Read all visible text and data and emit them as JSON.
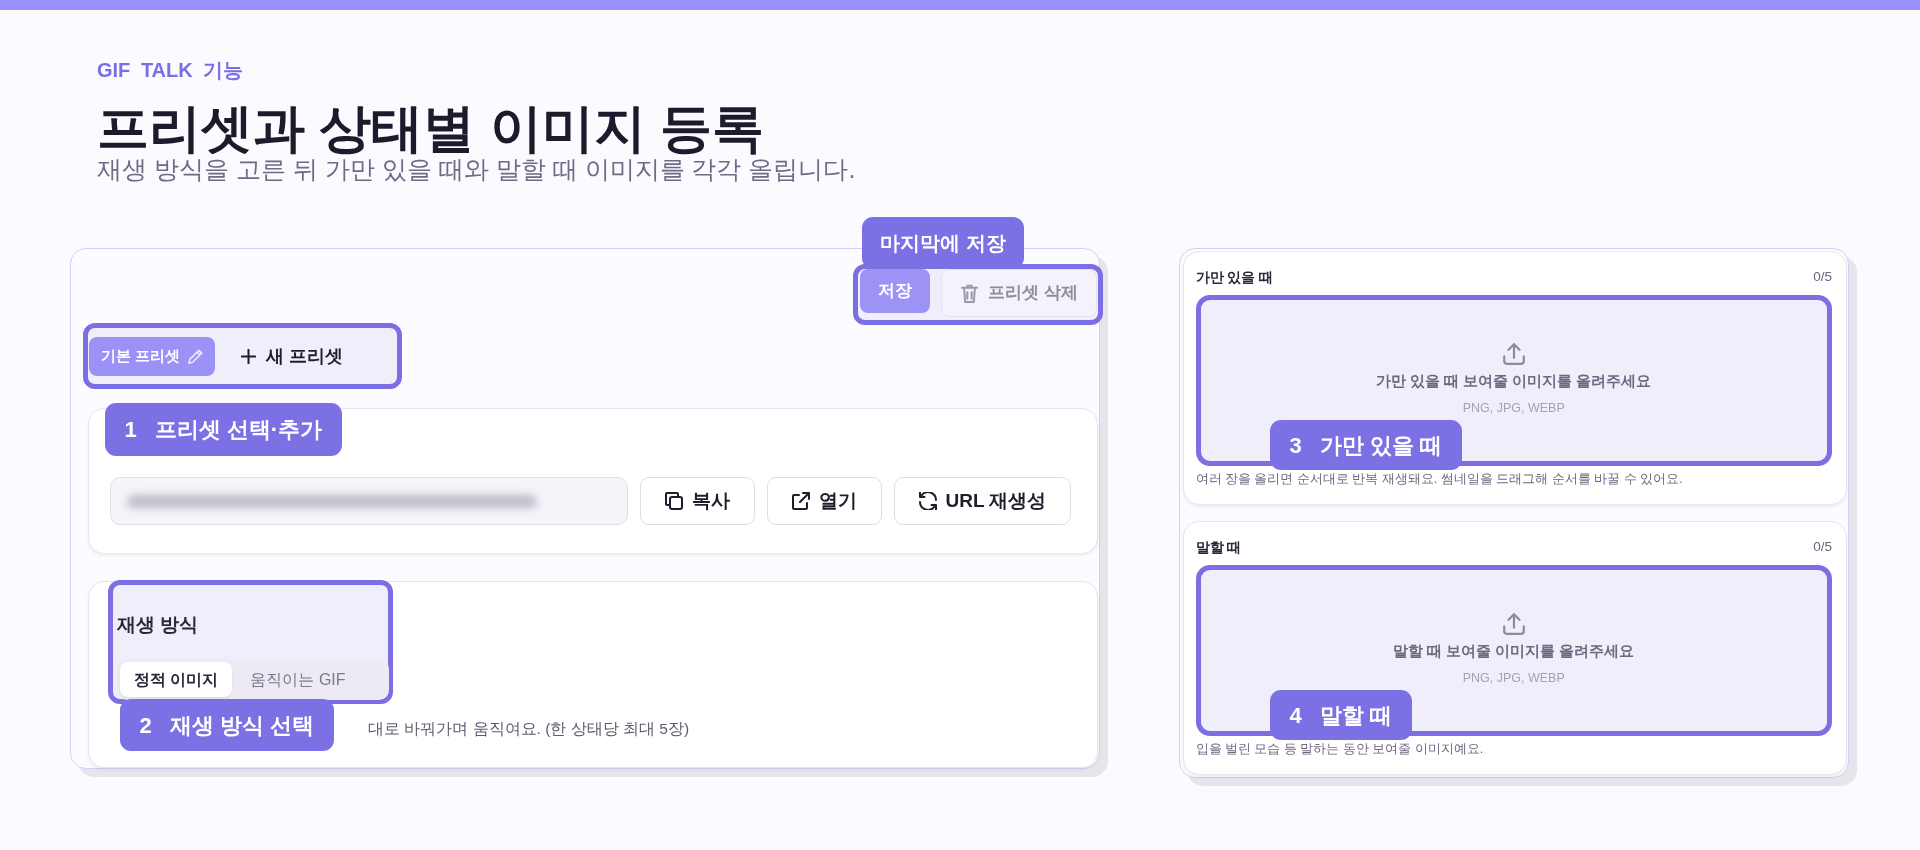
{
  "header": {
    "eyebrow": "GIF TALK 기능",
    "title": "프리셋과 상태별 이미지 등록",
    "subtitle": "재생 방식을 고른 뒤 가만 있을 때와 말할 때 이미지를 각각 올립니다."
  },
  "editor": {
    "actions": {
      "callout": {
        "text": "마지막에 저장"
      },
      "buttons": [
        {
          "kind": "save",
          "label": "저장"
        },
        {
          "kind": "delete",
          "label": "프리셋 삭제"
        }
      ]
    },
    "presets": {
      "items": [
        {
          "label": "기본 프리셋",
          "selected": true
        }
      ],
      "add_label": "새 프리셋"
    },
    "share": {
      "callout": {
        "number": "1",
        "text": "프리셋 선택·추가"
      },
      "buttons": [
        {
          "kind": "copy",
          "label": "복사"
        },
        {
          "kind": "open",
          "label": "열기"
        },
        {
          "kind": "regenerate",
          "label": "URL 재생성"
        }
      ]
    },
    "playback": {
      "callout": {
        "number": "2",
        "text": "재생 방식 선택"
      },
      "label": "재생 방식",
      "options": [
        {
          "label": "정적 이미지",
          "selected": true
        },
        {
          "label": "움직이는 GIF",
          "selected": false
        }
      ],
      "description": "대로 바꿔가며 움직여요. (한 상태당 최대 5장)"
    }
  },
  "states": [
    {
      "title": "가만 있을 때",
      "count": "0/5",
      "prompt": "가만 있을 때 보여줄 이미지를 올려주세요",
      "formats": "PNG, JPG, WEBP",
      "hint": "여러 장을 올리면 순서대로 반복 재생돼요. 썸네일을 드래그해 순서를 바꿀 수 있어요.",
      "callout": {
        "number": "3",
        "text": "가만 있을 때"
      }
    },
    {
      "title": "말할 때",
      "count": "0/5",
      "prompt": "말할 때 보여줄 이미지를 올려주세요",
      "formats": "PNG, JPG, WEBP",
      "hint": "입을 벌린 모습 등 말하는 동안 보여줄 이미지예요.",
      "callout": {
        "number": "4",
        "text": "말할 때"
      }
    }
  ]
}
